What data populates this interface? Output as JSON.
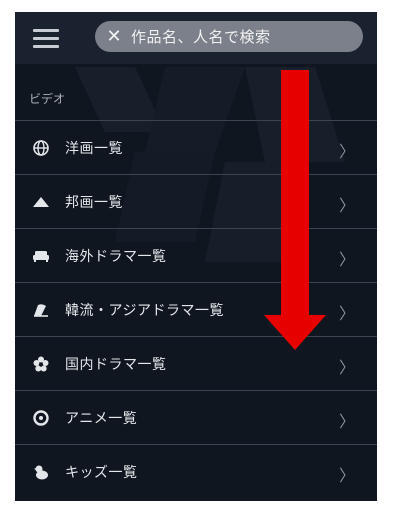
{
  "search": {
    "placeholder": "作品名、人名で検索",
    "clear_symbol": "✕"
  },
  "section": {
    "label": "ビデオ"
  },
  "menu": {
    "items": [
      {
        "label": "洋画一覧",
        "icon": "globe-icon"
      },
      {
        "label": "邦画一覧",
        "icon": "mountain-icon"
      },
      {
        "label": "海外ドラマ一覧",
        "icon": "sofa-icon"
      },
      {
        "label": "韓流・アジアドラマ一覧",
        "icon": "fan-icon"
      },
      {
        "label": "国内ドラマ一覧",
        "icon": "flower-icon"
      },
      {
        "label": "アニメ一覧",
        "icon": "anime-face-icon"
      },
      {
        "label": "キッズ一覧",
        "icon": "chick-icon"
      }
    ],
    "chevron": "〉"
  },
  "annotation": {
    "arrow_color": "#e60000",
    "direction": "down"
  }
}
